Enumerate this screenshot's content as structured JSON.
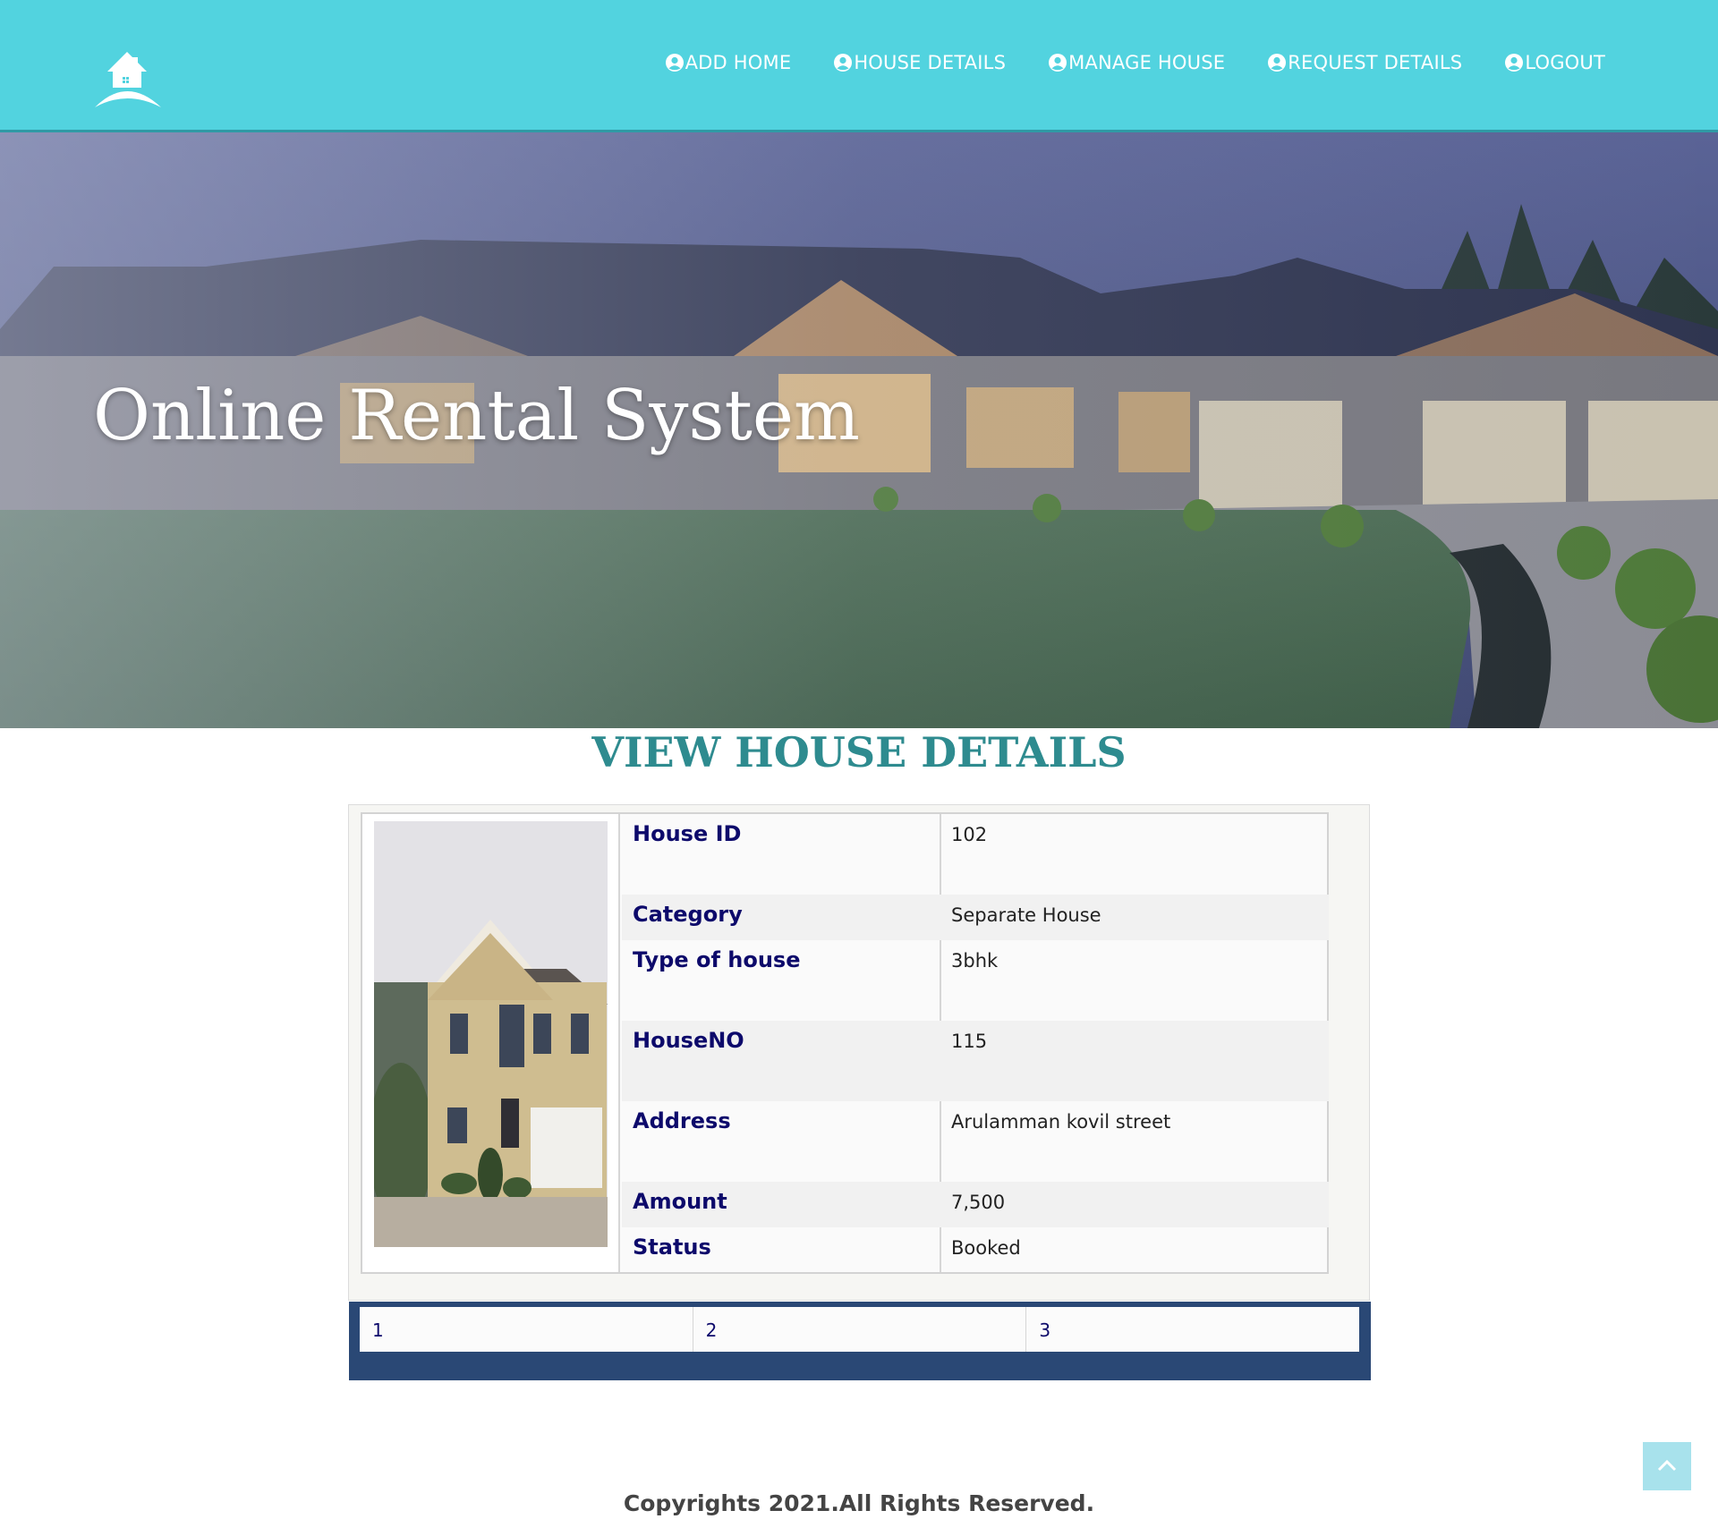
{
  "header": {
    "logo_icon": "house-logo-icon",
    "nav": [
      {
        "label": "ADD HOME",
        "icon": "user-circle-icon"
      },
      {
        "label": "HOUSE DETAILS",
        "icon": "user-circle-icon"
      },
      {
        "label": "MANAGE HOUSE",
        "icon": "user-circle-icon"
      },
      {
        "label": "REQUEST DETAILS",
        "icon": "user-circle-icon"
      },
      {
        "label": "LOGOUT",
        "icon": "user-circle-icon"
      }
    ]
  },
  "hero": {
    "title": "Online Rental System"
  },
  "section": {
    "title": "VIEW HOUSE DETAILS"
  },
  "house": {
    "rows": [
      {
        "label": "House ID",
        "value": "102"
      },
      {
        "label": "Category",
        "value": "Separate House"
      },
      {
        "label": "Type of house",
        "value": "3bhk"
      },
      {
        "label": "HouseNO",
        "value": "115"
      },
      {
        "label": "Address",
        "value": "Arulamman kovil street"
      },
      {
        "label": "Amount",
        "value": "7,500"
      },
      {
        "label": "Status",
        "value": "Booked"
      }
    ]
  },
  "pagination": {
    "pages": [
      "1",
      "2",
      "3"
    ]
  },
  "footer": {
    "text": "Copyrights 2021.All Rights Reserved."
  },
  "colors": {
    "header_bg": "#52d3df",
    "title_teal": "#2e8b8f",
    "label_navy": "#0d0a6b",
    "pager_bg": "#2a4875"
  }
}
